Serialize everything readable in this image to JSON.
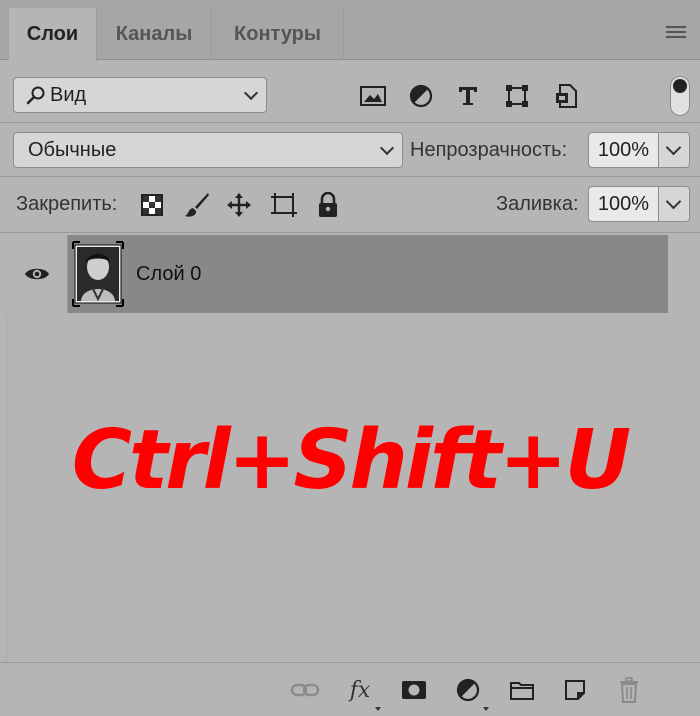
{
  "tabs": [
    {
      "label": "Слои",
      "active": true
    },
    {
      "label": "Каналы",
      "active": false
    },
    {
      "label": "Контуры",
      "active": false
    }
  ],
  "filter": {
    "label": "Вид",
    "icons": [
      "image-filter-icon",
      "adjustment-filter-icon",
      "type-filter-icon",
      "shape-filter-icon",
      "smart-object-filter-icon"
    ]
  },
  "blend": {
    "mode": "Обычные",
    "opacity_label": "Непрозрачность:",
    "opacity_value": "100%"
  },
  "lock": {
    "label": "Закрепить:",
    "fill_label": "Заливка:",
    "fill_value": "100%",
    "icons": [
      "lock-transparent-pixels-icon",
      "lock-image-pixels-icon",
      "lock-position-icon",
      "lock-artboard-icon",
      "lock-all-icon"
    ]
  },
  "layers": [
    {
      "name": "Слой 0",
      "visible": true,
      "selected": true
    }
  ],
  "overlay_text": "Ctrl+Shift+U",
  "footer": {
    "fx_label": "fx",
    "icons": [
      "link-layers-icon",
      "fx-icon",
      "layer-mask-icon",
      "adjustment-layer-icon",
      "group-folder-icon",
      "new-layer-icon",
      "trash-icon"
    ]
  },
  "colors": {
    "panel_bg": "#b5b5b5",
    "selected_layer": "#888888",
    "overlay_text": "#ff0000"
  }
}
